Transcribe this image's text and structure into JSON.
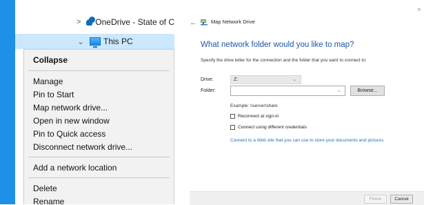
{
  "explorer": {
    "nav": [
      {
        "chevron": ">",
        "icon": "onedrive-cloud-icon",
        "label": "OneDrive - State of C"
      },
      {
        "chevron": "✓",
        "icon": "this-pc-icon",
        "label": "This PC"
      }
    ]
  },
  "context_menu": {
    "items": [
      {
        "label": "Collapse",
        "bold": true
      },
      {
        "label": "Manage"
      },
      {
        "label": "Pin to Start"
      },
      {
        "label": "Map network drive..."
      },
      {
        "label": "Open in new window"
      },
      {
        "label": "Pin to Quick access"
      },
      {
        "label": "Disconnect network drive..."
      },
      {
        "label": "Add a network location"
      },
      {
        "label": "Delete"
      },
      {
        "label": "Rename"
      }
    ]
  },
  "dialog": {
    "title": "Map Network Drive",
    "heading": "What network folder would you like to map?",
    "instruction": "Specify the drive letter for the connection and the folder that you want to connect to:",
    "drive_label": "Drive:",
    "drive_value": "Z:",
    "folder_label": "Folder:",
    "folder_value": "",
    "browse_label": "Browse...",
    "example": "Example: \\\\server\\share",
    "reconnect_label": "Reconnect at sign-in",
    "reconnect_checked": false,
    "credentials_label": "Connect using different credentials",
    "credentials_checked": false,
    "link_text": "Connect to a Web site that you can use to store your documents and pictures.",
    "finish_label": "Finish",
    "cancel_label": "Cancel",
    "close_glyph": "×",
    "back_glyph": "←"
  },
  "colors": {
    "accent_blue": "#1e90e8",
    "heading_blue": "#1f56a3",
    "link_blue": "#1f6cc7",
    "selected_row": "#cce8ff"
  }
}
